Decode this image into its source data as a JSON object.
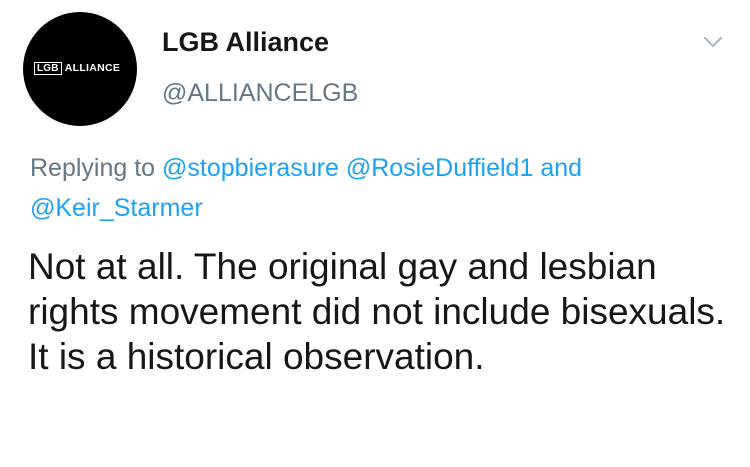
{
  "account": {
    "display_name": "LGB Alliance",
    "handle": "@ALLIANCELGB",
    "avatar_logo_box": "LGB",
    "avatar_logo_word": "ALLIANCE"
  },
  "reply": {
    "prefix": "Replying to",
    "mentions": [
      "@stopbierasure",
      "@RosieDuffield1",
      "@Keir_Starmer"
    ],
    "conjunction": "and"
  },
  "tweet": {
    "text": "Not at all. The original gay and lesbian rights movement did not include bisexuals. It is a historical observation."
  },
  "icons": {
    "menu": "chevron-down-icon"
  },
  "colors": {
    "link": "#1da1f2",
    "secondary_text": "#657786",
    "primary_text": "#14171a",
    "avatar_bg": "#000000",
    "chevron": "#aab8c2"
  }
}
